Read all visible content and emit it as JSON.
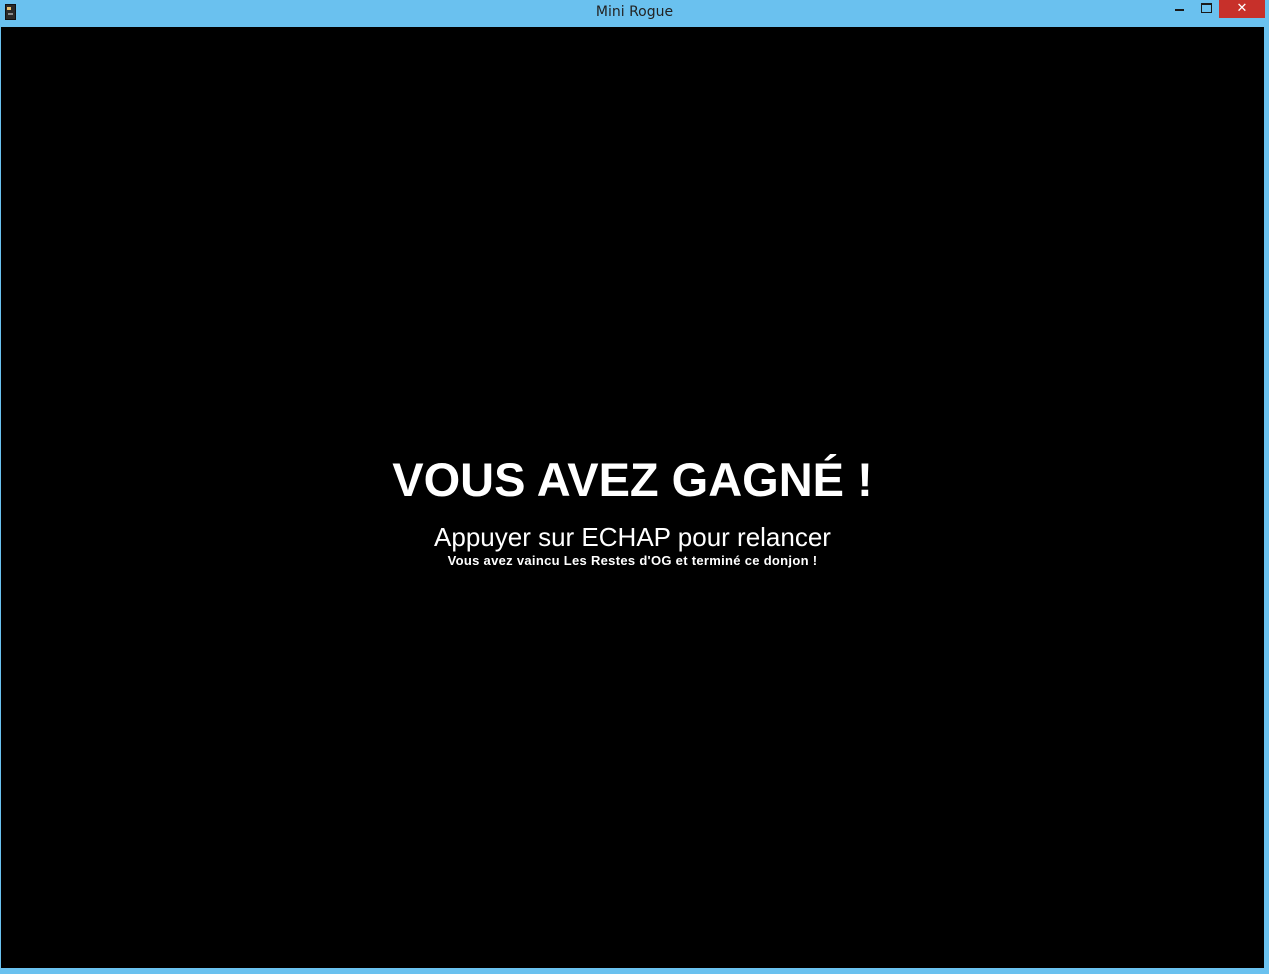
{
  "window": {
    "title": "Mini Rogue",
    "controls": {
      "minimize_icon": "minimize-icon",
      "maximize_icon": "maximize-icon",
      "close_label": "✕"
    },
    "accent_color": "#6ac1ef",
    "close_color": "#c7302a"
  },
  "game": {
    "background_color": "#000000",
    "headline": "VOUS AVEZ GAGNÉ !",
    "prompt": "Appuyer sur ECHAP pour relancer",
    "subtext": "Vous avez vaincu Les Restes d'OG et terminé ce donjon !"
  }
}
